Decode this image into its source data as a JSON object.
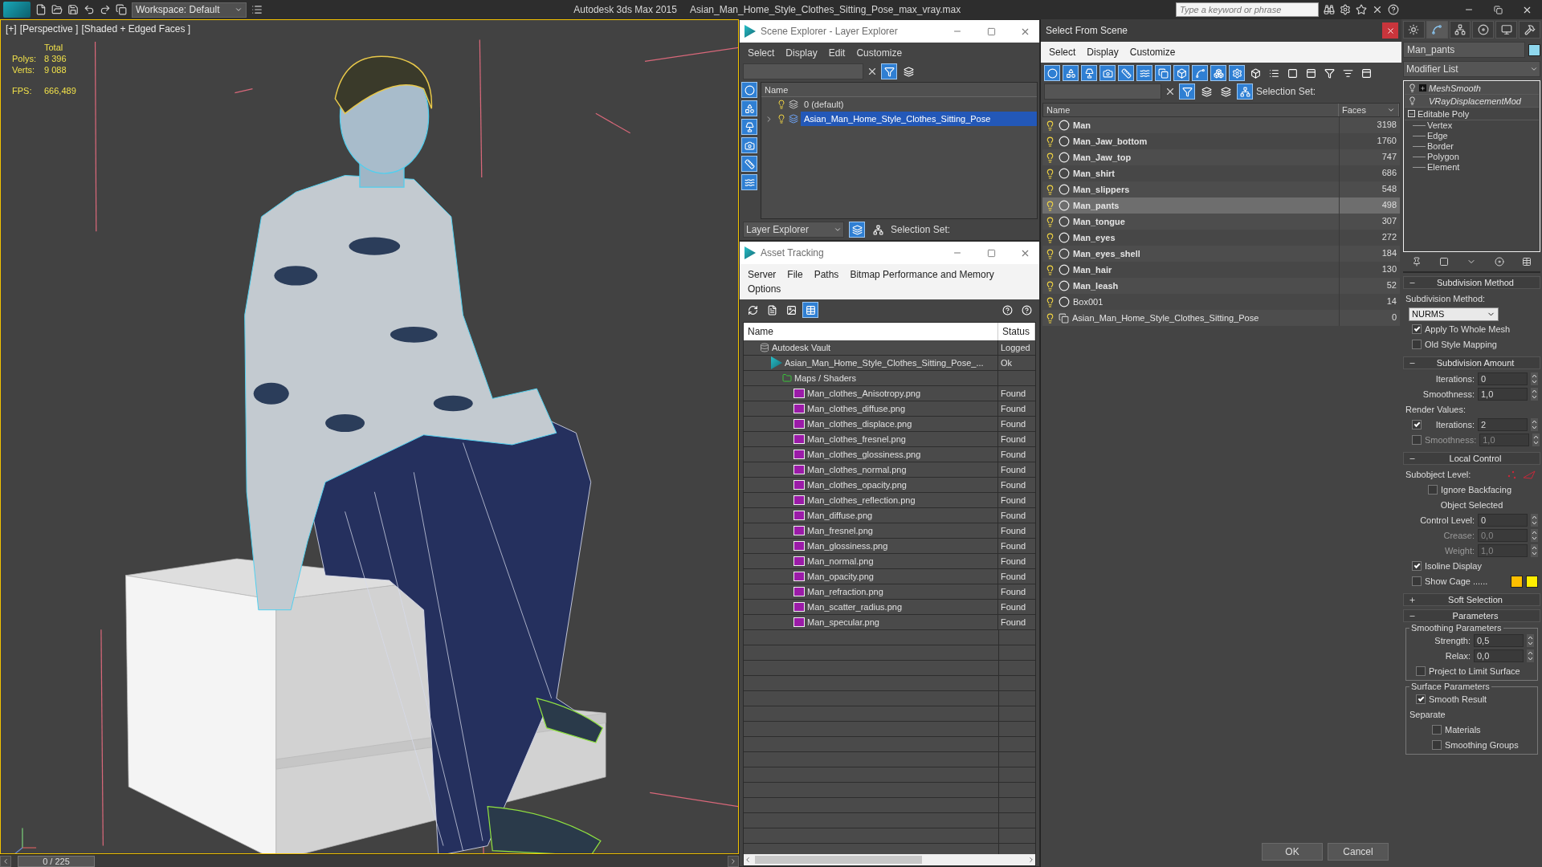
{
  "title_bar": {
    "workspace": "Workspace: Default",
    "app_title": "Autodesk 3ds Max  2015",
    "file_name": "Asian_Man_Home_Style_Clothes_Sitting_Pose_max_vray.max",
    "search_placeholder": "Type a keyword or phrase"
  },
  "viewport": {
    "menus": [
      "[+]",
      "[Perspective ]",
      "[Shaded + Edged Faces ]"
    ],
    "stats_header": "Total",
    "stats": [
      {
        "label": "Polys:",
        "value": "8 396"
      },
      {
        "label": "Verts:",
        "value": "9 088"
      }
    ],
    "fps": {
      "label": "FPS:",
      "value": "666,489"
    }
  },
  "time_slider": {
    "reading": "0 / 225",
    "level": 0
  },
  "scene_explorer": {
    "title": "Scene Explorer - Layer Explorer",
    "menu": [
      "Select",
      "Display",
      "Edit",
      "Customize"
    ],
    "column": "Name",
    "layers": [
      {
        "name": "0 (default)",
        "selected": false
      },
      {
        "name": "Asian_Man_Home_Style_Clothes_Sitting_Pose",
        "selected": true,
        "expanded": false
      }
    ],
    "explorer_type": "Layer Explorer",
    "selection_set_label": "Selection Set:"
  },
  "asset_tracking": {
    "title": "Asset Tracking",
    "menu": [
      "Server",
      "File",
      "Paths",
      "Bitmap Performance and Memory",
      "Options"
    ],
    "columns": [
      "Name",
      "Status"
    ],
    "tree": [
      {
        "kind": "vault",
        "name": "Autodesk Vault",
        "status": "Logged",
        "children": [
          {
            "kind": "scene",
            "name": "Asian_Man_Home_Style_Clothes_Sitting_Pose_...",
            "status": "Ok",
            "children": [
              {
                "kind": "folder",
                "name": "Maps / Shaders",
                "children": [
                  {
                    "kind": "png",
                    "name": "Man_clothes_Anisotropy.png",
                    "status": "Found"
                  },
                  {
                    "kind": "png",
                    "name": "Man_clothes_diffuse.png",
                    "status": "Found"
                  },
                  {
                    "kind": "png",
                    "name": "Man_clothes_displace.png",
                    "status": "Found"
                  },
                  {
                    "kind": "png",
                    "name": "Man_clothes_fresnel.png",
                    "status": "Found"
                  },
                  {
                    "kind": "png",
                    "name": "Man_clothes_glossiness.png",
                    "status": "Found"
                  },
                  {
                    "kind": "png",
                    "name": "Man_clothes_normal.png",
                    "status": "Found"
                  },
                  {
                    "kind": "png",
                    "name": "Man_clothes_opacity.png",
                    "status": "Found"
                  },
                  {
                    "kind": "png",
                    "name": "Man_clothes_reflection.png",
                    "status": "Found"
                  },
                  {
                    "kind": "png",
                    "name": "Man_diffuse.png",
                    "status": "Found"
                  },
                  {
                    "kind": "png",
                    "name": "Man_fresnel.png",
                    "status": "Found"
                  },
                  {
                    "kind": "png",
                    "name": "Man_glossiness.png",
                    "status": "Found"
                  },
                  {
                    "kind": "png",
                    "name": "Man_normal.png",
                    "status": "Found"
                  },
                  {
                    "kind": "png",
                    "name": "Man_opacity.png",
                    "status": "Found"
                  },
                  {
                    "kind": "png",
                    "name": "Man_refraction.png",
                    "status": "Found"
                  },
                  {
                    "kind": "png",
                    "name": "Man_scatter_radius.png",
                    "status": "Found"
                  },
                  {
                    "kind": "png",
                    "name": "Man_specular.png",
                    "status": "Found"
                  }
                ]
              }
            ]
          }
        ]
      }
    ]
  },
  "select_from_scene": {
    "title": "Select From Scene",
    "menu": [
      "Select",
      "Display",
      "Customize"
    ],
    "selection_set_label": "Selection Set:",
    "columns": [
      "Name",
      "Faces"
    ],
    "rows": [
      {
        "kind": "mesh",
        "name": "Man",
        "faces": "3198",
        "selected": false
      },
      {
        "kind": "mesh",
        "name": "Man_Jaw_bottom",
        "faces": "1760",
        "selected": false
      },
      {
        "kind": "mesh",
        "name": "Man_Jaw_top",
        "faces": "747",
        "selected": false
      },
      {
        "kind": "mesh",
        "name": "Man_shirt",
        "faces": "686",
        "selected": false
      },
      {
        "kind": "mesh",
        "name": "Man_slippers",
        "faces": "548",
        "selected": false
      },
      {
        "kind": "mesh",
        "name": "Man_pants",
        "faces": "498",
        "selected": true
      },
      {
        "kind": "mesh",
        "name": "Man_tongue",
        "faces": "307",
        "selected": false
      },
      {
        "kind": "mesh",
        "name": "Man_eyes",
        "faces": "272",
        "selected": false
      },
      {
        "kind": "mesh",
        "name": "Man_eyes_shell",
        "faces": "184",
        "selected": false
      },
      {
        "kind": "mesh",
        "name": "Man_hair",
        "faces": "130",
        "selected": false
      },
      {
        "kind": "mesh",
        "name": "Man_leash",
        "faces": "52",
        "selected": false
      },
      {
        "kind": "box",
        "name": "Box001",
        "faces": "14",
        "selected": false
      },
      {
        "kind": "group",
        "name": "Asian_Man_Home_Style_Clothes_Sitting_Pose",
        "faces": "0",
        "selected": false
      }
    ],
    "buttons": [
      "OK",
      "Cancel"
    ]
  },
  "command_panel": {
    "tabs": [
      {
        "selected": false
      },
      {
        "selected": true
      },
      {
        "selected": false
      },
      {
        "selected": false
      },
      {
        "selected": false
      },
      {
        "selected": false
      }
    ],
    "object_name": "Man_pants",
    "modifier_list": "Modifier List",
    "stack": [
      {
        "kind": "modifier",
        "name": "MeshSmooth",
        "expanded": false
      },
      {
        "kind": "modifier",
        "name": "VRayDisplacementMod"
      },
      {
        "kind": "base",
        "name": "Editable Poly",
        "expanded": true,
        "children": [
          "Vertex",
          "Edge",
          "Border",
          "Polygon",
          "Element"
        ]
      }
    ],
    "rollouts": [
      {
        "title": "Subdivision Method",
        "expanded": true,
        "controls": [
          {
            "kind": "label",
            "text": "Subdivision Method:"
          },
          {
            "kind": "dropdown",
            "value": "NURMS"
          },
          {
            "kind": "checkbox",
            "label": "Apply To Whole Mesh",
            "checked": true
          },
          {
            "kind": "checkbox",
            "label": "Old Style Mapping",
            "checked": false
          }
        ]
      },
      {
        "title": "Subdivision Amount",
        "expanded": true,
        "controls": [
          {
            "kind": "spinner",
            "label": "Iterations:",
            "value": "0"
          },
          {
            "kind": "spinner",
            "label": "Smoothness:",
            "value": "1,0"
          },
          {
            "kind": "label",
            "text": "Render Values:"
          },
          {
            "kind": "check-spinner",
            "label": "Iterations:",
            "value": "2",
            "checked": true
          },
          {
            "kind": "check-spinner",
            "label": "Smoothness:",
            "value": "1,0",
            "checked": false
          }
        ]
      },
      {
        "title": "Local Control",
        "expanded": true,
        "controls": [
          {
            "kind": "subobject",
            "label": "Subobject Level:"
          },
          {
            "kind": "sub-checkbox",
            "label": "Ignore Backfacing",
            "checked": false
          },
          {
            "kind": "note",
            "text": "Object Selected"
          },
          {
            "kind": "spinner",
            "label": "Control Level:",
            "value": "0"
          },
          {
            "kind": "spinner",
            "label": "Crease:",
            "value": "0,0",
            "disabled": true
          },
          {
            "kind": "spinner",
            "label": "Weight:",
            "value": "1,0",
            "disabled": true
          },
          {
            "kind": "checkbox",
            "label": "Isoline Display",
            "checked": true
          },
          {
            "kind": "swatches",
            "label": "Show Cage ......",
            "checked": false,
            "swatches": [
              {
                "color": "#ffbf00"
              },
              {
                "color": "#ffee00"
              }
            ]
          }
        ]
      },
      {
        "title": "Soft Selection",
        "expanded": false
      },
      {
        "title": "Parameters",
        "expanded": true,
        "controls": [
          {
            "kind": "group",
            "title": "Smoothing Parameters",
            "controls": [
              {
                "kind": "spinner",
                "label": "Strength:",
                "value": "0,5"
              },
              {
                "kind": "spinner",
                "label": "Relax:",
                "value": "0,0"
              },
              {
                "kind": "checkbox",
                "label": "Project to Limit Surface",
                "checked": false
              }
            ]
          },
          {
            "kind": "group",
            "title": "Surface Parameters",
            "controls": [
              {
                "kind": "checkbox",
                "label": "Smooth Result",
                "checked": true
              },
              {
                "kind": "label",
                "text": "Separate"
              },
              {
                "kind": "sub-checkbox",
                "label": "Materials",
                "checked": false
              },
              {
                "kind": "sub-checkbox",
                "label": "Smoothing Groups",
                "checked": false
              }
            ]
          }
        ]
      }
    ]
  }
}
